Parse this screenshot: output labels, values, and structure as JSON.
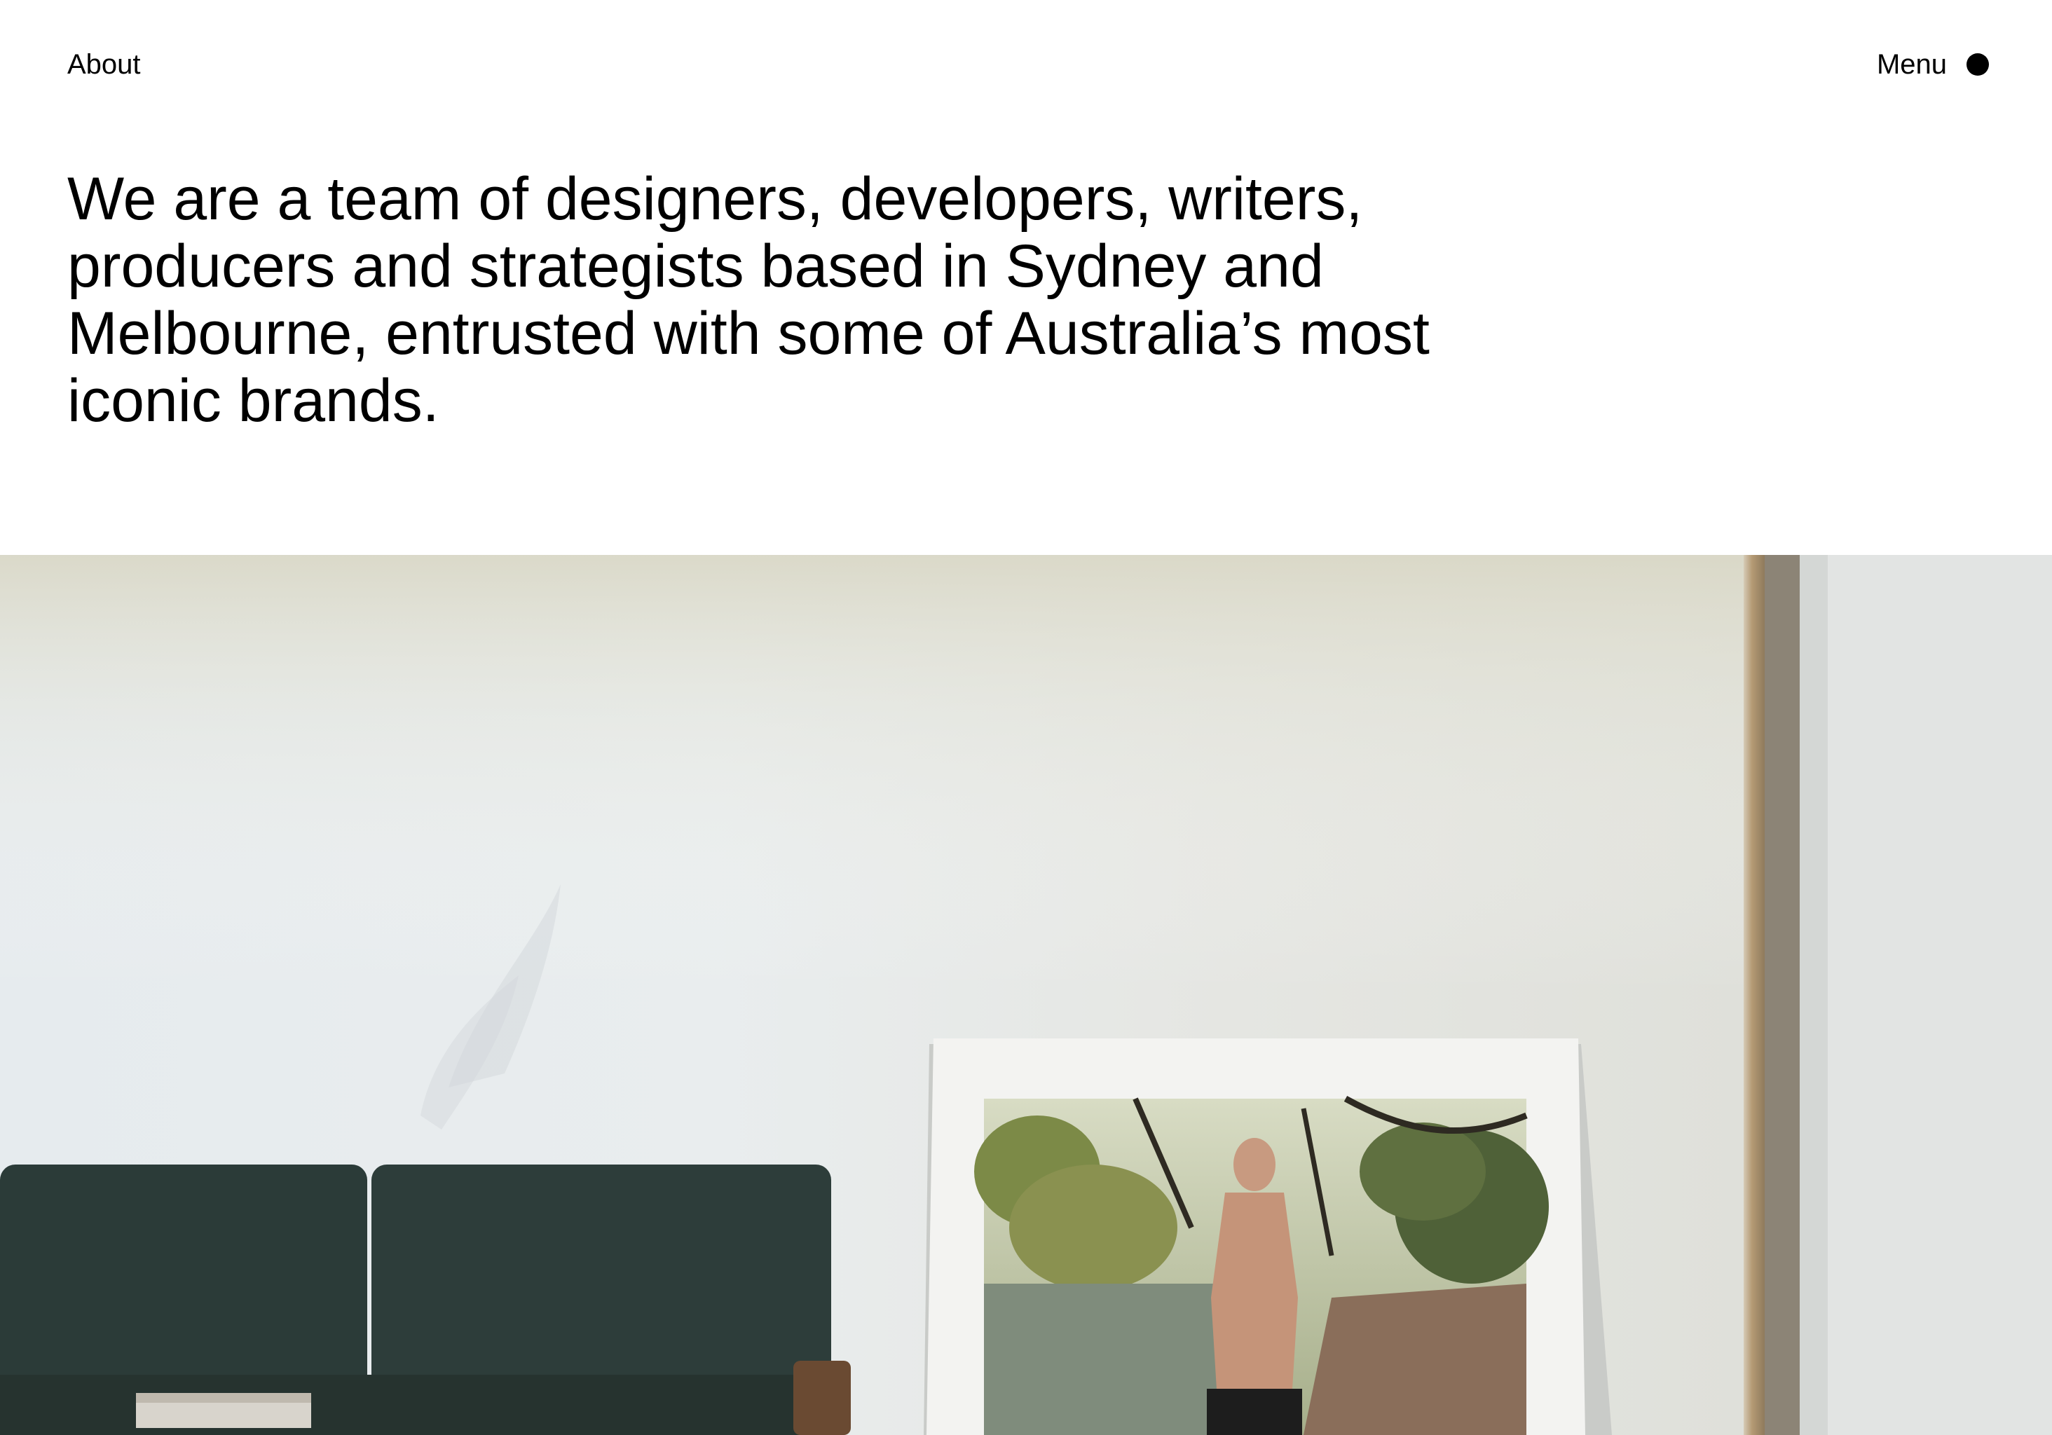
{
  "nav": {
    "about_label": "About",
    "menu_label": "Menu",
    "menu_icon": "filled-circle-icon"
  },
  "intro": {
    "text": "We are a team of designers, developers, writers, producers and strategists based in Sydney and Melbourne, entrusted with some of Australia’s most iconic brands."
  },
  "hero": {
    "description_icon": "room-photo",
    "colors": {
      "wall": "#e4e8ea",
      "sofa": "#2a3a37",
      "frame": "#f4f4f2",
      "door_trim": "#a98f6b"
    }
  }
}
